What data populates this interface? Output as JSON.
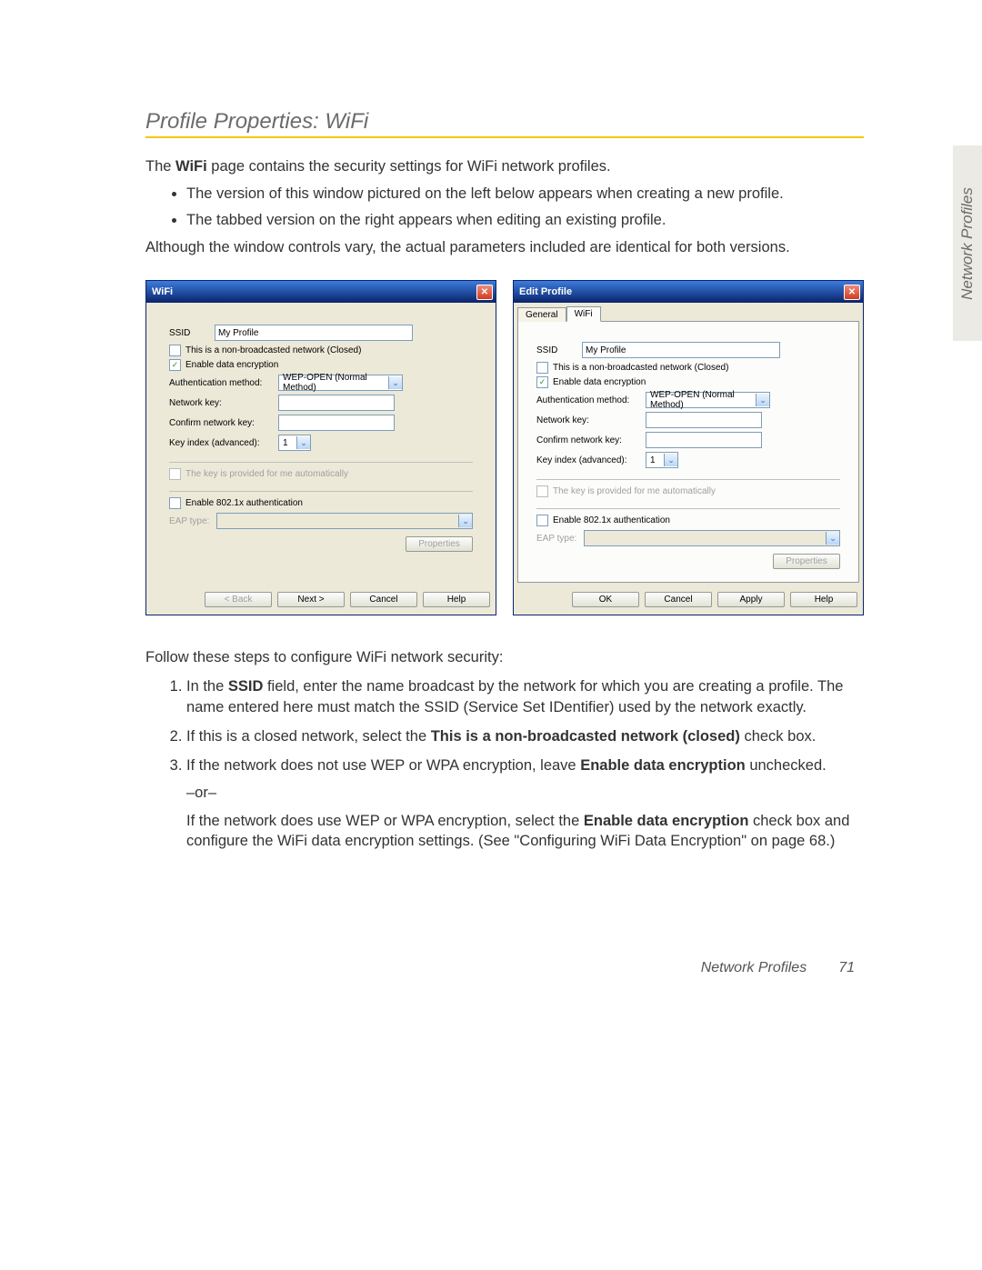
{
  "section_title": "Profile Properties: WiFi",
  "side_tab": "Network Profiles",
  "intro": {
    "line1_a": "The ",
    "line1_bold": "WiFi",
    "line1_b": " page contains the security settings for WiFi network profiles.",
    "bullet1": "The version of this window pictured on the left below appears when creating a new profile.",
    "bullet2": "The tabbed version on the right appears when editing an existing profile.",
    "line2": "Although the window controls vary, the actual parameters included are identical for both versions."
  },
  "dialog_left": {
    "title": "WiFi",
    "labels": {
      "ssid": "SSID",
      "non_broadcast": "This is a non-broadcasted network (Closed)",
      "enable_enc": "Enable data encryption",
      "auth_method": "Authentication method:",
      "netkey": "Network key:",
      "confkey": "Confirm network key:",
      "keyidx": "Key index (advanced):",
      "autokey": "The key is provided for me automatically",
      "enable8021x": "Enable 802.1x authentication",
      "eap": "EAP type:"
    },
    "values": {
      "ssid": "My Profile",
      "auth_method": "WEP-OPEN (Normal Method)",
      "keyidx": "1"
    },
    "buttons": {
      "properties": "Properties",
      "back": "< Back",
      "next": "Next >",
      "cancel": "Cancel",
      "help": "Help"
    }
  },
  "dialog_right": {
    "title": "Edit Profile",
    "tabs": {
      "general": "General",
      "wifi": "WiFi"
    },
    "labels": {
      "ssid": "SSID",
      "non_broadcast": "This is a non-broadcasted network (Closed)",
      "enable_enc": "Enable data encryption",
      "auth_method": "Authentication method:",
      "netkey": "Network key:",
      "confkey": "Confirm network key:",
      "keyidx": "Key index (advanced):",
      "autokey": "The key is provided for me automatically",
      "enable8021x": "Enable 802.1x authentication",
      "eap": "EAP type:"
    },
    "values": {
      "ssid": "My Profile",
      "auth_method": "WEP-OPEN (Normal Method)",
      "keyidx": "1"
    },
    "buttons": {
      "properties": "Properties",
      "ok": "OK",
      "cancel": "Cancel",
      "apply": "Apply",
      "help": "Help"
    }
  },
  "steps_intro": "Follow these steps to configure WiFi network security:",
  "steps": {
    "s1_a": "In the ",
    "s1_bold": "SSID",
    "s1_b": " field, enter the name broadcast by the network for which you are creating a profile. The name entered here must match the SSID (Service Set IDentifier) used by the network exactly.",
    "s2_a": "If this is a closed network, select the ",
    "s2_bold": "This is a non-broadcasted network (closed)",
    "s2_b": " check box.",
    "s3_a": "If the network does not use WEP or WPA encryption, leave ",
    "s3_bold": "Enable data encryption",
    "s3_b": " unchecked.",
    "s3_or": "–or–",
    "s3_c": "If the network does use WEP or WPA encryption, select the ",
    "s3_bold2": "Enable data encryption",
    "s3_d": " check box and configure the WiFi data encryption settings. (See \"Configuring WiFi Data Encryption\" on page 68.)"
  },
  "footer": {
    "section": "Network Profiles",
    "page": "71"
  }
}
